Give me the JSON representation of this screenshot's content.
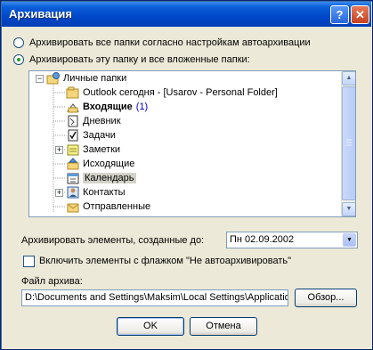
{
  "window": {
    "title": "Архивация",
    "help_label": "?",
    "close_label": "✕"
  },
  "options": {
    "radio_all": "Архивировать все папки согласно настройкам автоархивации",
    "radio_this": "Архивировать эту папку и все вложенные папки:",
    "selected": "radio_this"
  },
  "tree": {
    "items": [
      {
        "label": "Личные папки",
        "icon": "personal-folders-icon",
        "expander": "−"
      },
      {
        "label": "Outlook сегодня - [Usarov - Personal Folder]",
        "icon": "outlook-today-icon"
      },
      {
        "label": "Входящие",
        "count": "(1)",
        "bold": true,
        "icon": "inbox-icon"
      },
      {
        "label": "Дневник",
        "icon": "journal-icon"
      },
      {
        "label": "Задачи",
        "icon": "tasks-icon"
      },
      {
        "label": "Заметки",
        "icon": "notes-icon",
        "expander": "+"
      },
      {
        "label": "Исходящие",
        "icon": "outbox-icon"
      },
      {
        "label": "Календарь",
        "icon": "calendar-icon",
        "selected": true
      },
      {
        "label": "Контакты",
        "icon": "contacts-icon",
        "expander": "+"
      },
      {
        "label": "Отправленные",
        "icon": "sent-items-icon"
      }
    ]
  },
  "archive_before": {
    "label": "Архивировать элементы, созданные до:",
    "value": "Пн 02.09.2002"
  },
  "include_flagged": {
    "label": "Включить элементы с флажком \"Не автоархивировать\"",
    "checked": false
  },
  "archive_file": {
    "label": "Файл архива:",
    "value": "D:\\Documents and Settings\\Maksim\\Local Settings\\Application",
    "browse_label": "Обзор..."
  },
  "buttons": {
    "ok": "OK",
    "cancel": "Отмена"
  },
  "colors": {
    "title_bar": "#0047c9",
    "dialog_bg": "#ece9d8",
    "selection": "#d3d2c8",
    "count": "#0000cc"
  }
}
